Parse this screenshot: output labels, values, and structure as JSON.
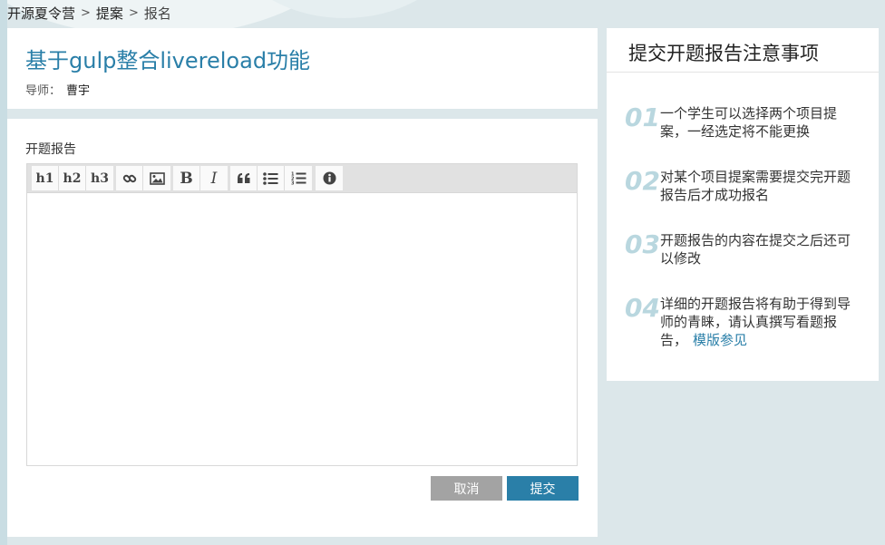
{
  "breadcrumb": {
    "items": [
      "开源夏令营",
      "提案",
      "报名"
    ],
    "separator": ">"
  },
  "project": {
    "title": "基于gulp整合livereload功能",
    "mentor_label": "导师：",
    "mentor_name": "曹宇"
  },
  "form": {
    "label": "开题报告",
    "editor_value": "",
    "toolbar": {
      "h1": "h1",
      "h2": "h2",
      "h3": "h3",
      "bold": "B",
      "italic": "I",
      "icons": [
        "link-icon",
        "image-icon",
        "quote-icon",
        "bullet-list-icon",
        "numbered-list-icon",
        "info-icon"
      ]
    },
    "cancel_label": "取消",
    "submit_label": "提交"
  },
  "notes": {
    "title": "提交开题报告注意事项",
    "items": [
      {
        "num": "01",
        "text": "一个学生可以选择两个项目提案，一经选定将不能更换"
      },
      {
        "num": "02",
        "text": "对某个项目提案需要提交完开题报告后才成功报名"
      },
      {
        "num": "03",
        "text": "开题报告的内容在提交之后还可以修改"
      },
      {
        "num": "04",
        "text": "详细的开题报告将有助于得到导师的青睐，请认真撰写看题报告，",
        "link": "模版参见"
      }
    ]
  },
  "colors": {
    "accent": "#2a7fa8",
    "background": "#dce7ea",
    "cancel": "#a3a3a3",
    "note_number": "#b9d7df"
  }
}
